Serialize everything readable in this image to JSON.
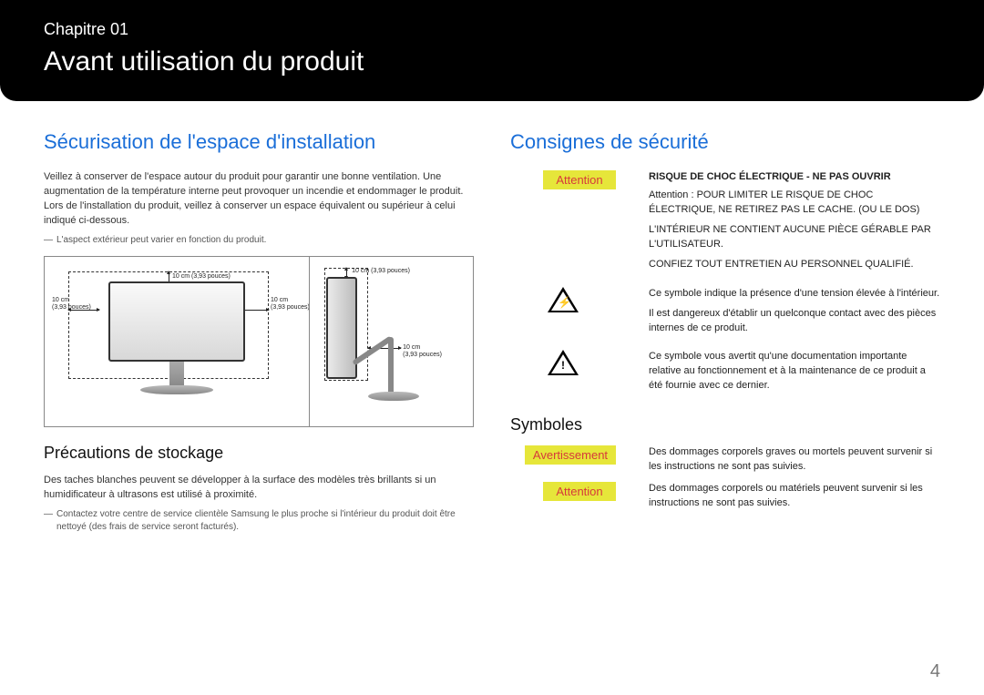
{
  "header": {
    "chapter_label": "Chapitre 01",
    "chapter_title": "Avant utilisation du produit"
  },
  "left": {
    "heading": "Sécurisation de l'espace d'installation",
    "body": "Veillez à conserver de l'espace autour du produit pour garantir une bonne ventilation. Une augmentation de la température interne peut provoquer un incendie et endommager le produit. Lors de l'installation du produit, veillez à conserver un espace équivalent ou supérieur à celui indiqué ci-dessous.",
    "note": "L'aspect extérieur peut varier en fonction du produit.",
    "dimensions": {
      "top": "10 cm (3,93 pouces)",
      "left_cm": "10 cm",
      "left_in": "(3,93 pouces)",
      "right_cm": "10 cm",
      "right_in": "(3,93 pouces)",
      "side_top": "10 cm (3,93 pouces)",
      "side_back_cm": "10 cm",
      "side_back_in": "(3,93 pouces)"
    },
    "precautions_heading": "Précautions de stockage",
    "precautions_body": "Des taches blanches peuvent se développer à la surface des modèles très brillants si un humidificateur à ultrasons est utilisé à proximité.",
    "precautions_note": "Contactez votre centre de service clientèle Samsung le plus proche si l'intérieur du produit doit être nettoyé (des frais de service seront facturés)."
  },
  "right": {
    "heading": "Consignes de sécurité",
    "attention_label": "Attention",
    "risk_title": "RISQUE DE CHOC ÉLECTRIQUE - NE PAS OUVRIR",
    "risk_p1": "Attention : POUR LIMITER LE RISQUE DE CHOC ÉLECTRIQUE, NE RETIREZ PAS LE CACHE. (OU LE DOS)",
    "risk_p2": "L'INTÉRIEUR NE CONTIENT AUCUNE PIÈCE GÉRABLE PAR L'UTILISATEUR.",
    "risk_p3": "CONFIEZ TOUT ENTRETIEN AU PERSONNEL QUALIFIÉ.",
    "bolt_text_1": "Ce symbole indique la présence d'une tension élevée à l'intérieur.",
    "bolt_text_2": "Il est dangereux d'établir un quelconque contact avec des pièces internes de ce produit.",
    "excl_text": "Ce symbole vous avertit qu'une documentation importante relative au fonctionnement et à la maintenance de ce produit a été fournie avec ce dernier.",
    "symbols_heading": "Symboles",
    "avert_label": "Avertissement",
    "avert_text": "Des dommages corporels graves ou mortels peuvent survenir si les instructions ne sont pas suivies.",
    "att2_label": "Attention",
    "att2_text": "Des dommages corporels ou matériels peuvent survenir si les instructions ne sont pas suivies."
  },
  "page_number": "4"
}
